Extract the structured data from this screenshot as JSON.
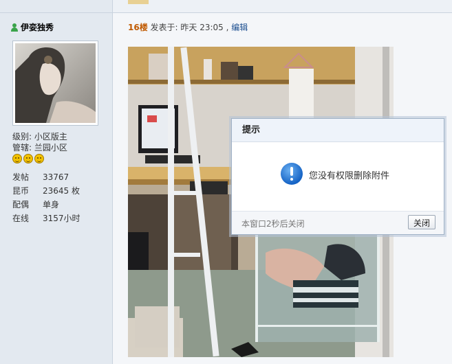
{
  "user": {
    "name": "伊娈独秀",
    "level": "级别: 小区版主",
    "jurisdiction": "管辖: 兰园小区",
    "stats": [
      {
        "key": "发帖",
        "value": "33767"
      },
      {
        "key": "昆币",
        "value": "23645 枚"
      },
      {
        "key": "配偶",
        "value": "单身"
      },
      {
        "key": "在线",
        "value": "3157小时"
      }
    ]
  },
  "post": {
    "floor": "16楼",
    "posted": "发表于: 昨天 23:05 ,",
    "edit": "编辑"
  },
  "dialog": {
    "title": "提示",
    "message": "您没有权限删除附件",
    "autoclose": "本窗口2秒后关闭",
    "close_button": "关闭"
  },
  "colors": {
    "sidebar": "#e3e9f0",
    "floor": "#c05a00",
    "link": "#1a4d8f",
    "info": "#1563c5"
  }
}
